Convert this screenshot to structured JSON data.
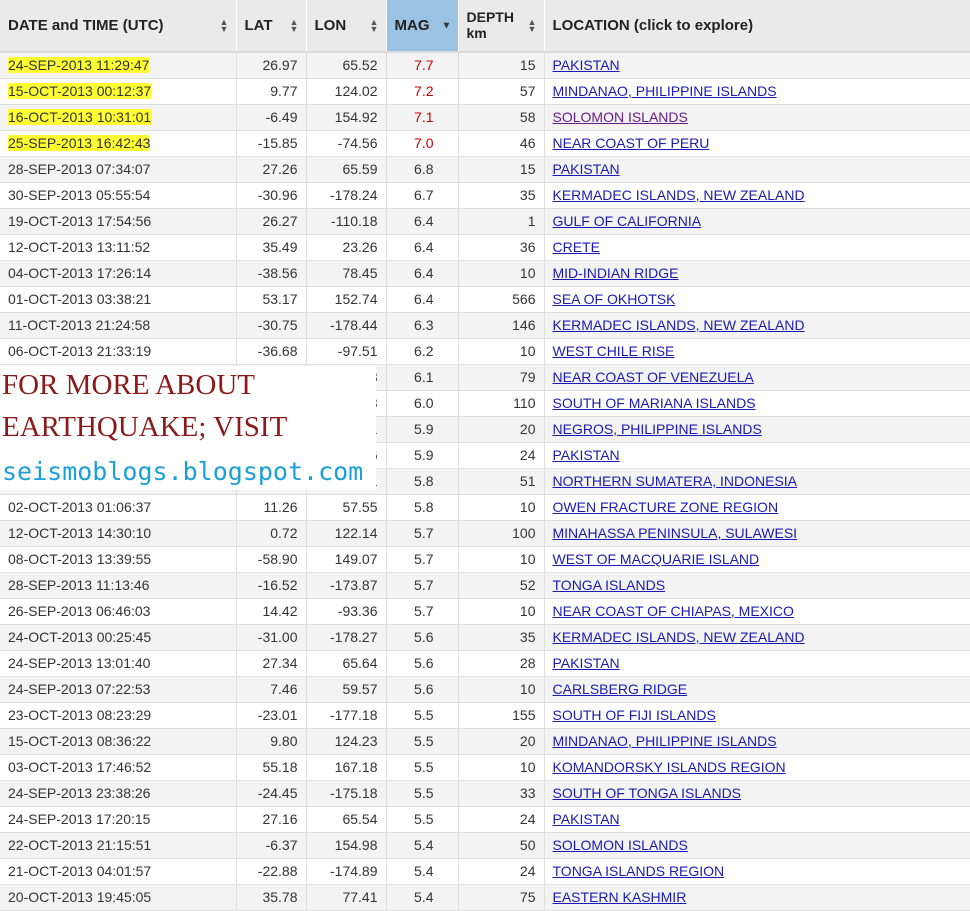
{
  "table": {
    "headers": {
      "date": "DATE and TIME (UTC)",
      "lat": "LAT",
      "lon": "LON",
      "mag": "MAG",
      "depth_line1": "DEPTH",
      "depth_line2": "km",
      "location": "LOCATION  (click to explore)"
    },
    "sort": {
      "column": "MAG",
      "direction": "descending"
    },
    "rows": [
      {
        "date": "24-SEP-2013 11:29:47",
        "lat": "26.97",
        "lon": "65.52",
        "mag": "7.7",
        "depth": "15",
        "location": "PAKISTAN"
      },
      {
        "date": "15-OCT-2013 00:12:37",
        "lat": "9.77",
        "lon": "124.02",
        "mag": "7.2",
        "depth": "57",
        "location": "MINDANAO, PHILIPPINE ISLANDS"
      },
      {
        "date": "16-OCT-2013 10:31:01",
        "lat": "-6.49",
        "lon": "154.92",
        "mag": "7.1",
        "depth": "58",
        "location": "SOLOMON ISLANDS"
      },
      {
        "date": "25-SEP-2013 16:42:43",
        "lat": "-15.85",
        "lon": "-74.56",
        "mag": "7.0",
        "depth": "46",
        "location": "NEAR COAST OF PERU"
      },
      {
        "date": "28-SEP-2013 07:34:07",
        "lat": "27.26",
        "lon": "65.59",
        "mag": "6.8",
        "depth": "15",
        "location": "PAKISTAN"
      },
      {
        "date": "30-SEP-2013 05:55:54",
        "lat": "-30.96",
        "lon": "-178.24",
        "mag": "6.7",
        "depth": "35",
        "location": "KERMADEC ISLANDS, NEW ZEALAND"
      },
      {
        "date": "19-OCT-2013 17:54:56",
        "lat": "26.27",
        "lon": "-110.18",
        "mag": "6.4",
        "depth": "1",
        "location": "GULF OF CALIFORNIA"
      },
      {
        "date": "12-OCT-2013 13:11:52",
        "lat": "35.49",
        "lon": "23.26",
        "mag": "6.4",
        "depth": "36",
        "location": "CRETE"
      },
      {
        "date": "04-OCT-2013 17:26:14",
        "lat": "-38.56",
        "lon": "78.45",
        "mag": "6.4",
        "depth": "10",
        "location": "MID-INDIAN RIDGE"
      },
      {
        "date": "01-OCT-2013 03:38:21",
        "lat": "53.17",
        "lon": "152.74",
        "mag": "6.4",
        "depth": "566",
        "location": "SEA OF OKHOTSK"
      },
      {
        "date": "11-OCT-2013 21:24:58",
        "lat": "-30.75",
        "lon": "-178.44",
        "mag": "6.3",
        "depth": "146",
        "location": "KERMADEC ISLANDS, NEW ZEALAND"
      },
      {
        "date": "06-OCT-2013 21:33:19",
        "lat": "-36.68",
        "lon": "-97.51",
        "mag": "6.2",
        "depth": "10",
        "location": "WEST CHILE RISE"
      },
      {
        "date": "",
        "lat": "",
        "lon": "3",
        "mag": "6.1",
        "depth": "79",
        "location": "NEAR COAST OF VENEZUELA"
      },
      {
        "date": "",
        "lat": "",
        "lon": "3",
        "mag": "6.0",
        "depth": "110",
        "location": "SOUTH OF MARIANA ISLANDS"
      },
      {
        "date": "",
        "lat": "",
        "lon": "1",
        "mag": "5.9",
        "depth": "20",
        "location": "NEGROS, PHILIPPINE ISLANDS"
      },
      {
        "date": "",
        "lat": "",
        "lon": "6",
        "mag": "5.9",
        "depth": "24",
        "location": "PAKISTAN"
      },
      {
        "date": "",
        "lat": "",
        "lon": "1",
        "mag": "5.8",
        "depth": "51",
        "location": "NORTHERN SUMATERA, INDONESIA"
      },
      {
        "date": "02-OCT-2013 01:06:37",
        "lat": "11.26",
        "lon": "57.55",
        "mag": "5.8",
        "depth": "10",
        "location": "OWEN FRACTURE ZONE REGION"
      },
      {
        "date": "12-OCT-2013 14:30:10",
        "lat": "0.72",
        "lon": "122.14",
        "mag": "5.7",
        "depth": "100",
        "location": "MINAHASSA PENINSULA, SULAWESI"
      },
      {
        "date": "08-OCT-2013 13:39:55",
        "lat": "-58.90",
        "lon": "149.07",
        "mag": "5.7",
        "depth": "10",
        "location": "WEST OF MACQUARIE ISLAND"
      },
      {
        "date": "28-SEP-2013 11:13:46",
        "lat": "-16.52",
        "lon": "-173.87",
        "mag": "5.7",
        "depth": "52",
        "location": "TONGA ISLANDS"
      },
      {
        "date": "26-SEP-2013 06:46:03",
        "lat": "14.42",
        "lon": "-93.36",
        "mag": "5.7",
        "depth": "10",
        "location": "NEAR COAST OF CHIAPAS, MEXICO"
      },
      {
        "date": "24-OCT-2013 00:25:45",
        "lat": "-31.00",
        "lon": "-178.27",
        "mag": "5.6",
        "depth": "35",
        "location": "KERMADEC ISLANDS, NEW ZEALAND"
      },
      {
        "date": "24-SEP-2013 13:01:40",
        "lat": "27.34",
        "lon": "65.64",
        "mag": "5.6",
        "depth": "28",
        "location": "PAKISTAN"
      },
      {
        "date": "24-SEP-2013 07:22:53",
        "lat": "7.46",
        "lon": "59.57",
        "mag": "5.6",
        "depth": "10",
        "location": "CARLSBERG RIDGE"
      },
      {
        "date": "23-OCT-2013 08:23:29",
        "lat": "-23.01",
        "lon": "-177.18",
        "mag": "5.5",
        "depth": "155",
        "location": "SOUTH OF FIJI ISLANDS"
      },
      {
        "date": "15-OCT-2013 08:36:22",
        "lat": "9.80",
        "lon": "124.23",
        "mag": "5.5",
        "depth": "20",
        "location": "MINDANAO, PHILIPPINE ISLANDS"
      },
      {
        "date": "03-OCT-2013 17:46:52",
        "lat": "55.18",
        "lon": "167.18",
        "mag": "5.5",
        "depth": "10",
        "location": "KOMANDORSKY ISLANDS REGION"
      },
      {
        "date": "24-SEP-2013 23:38:26",
        "lat": "-24.45",
        "lon": "-175.18",
        "mag": "5.5",
        "depth": "33",
        "location": "SOUTH OF TONGA ISLANDS"
      },
      {
        "date": "24-SEP-2013 17:20:15",
        "lat": "27.16",
        "lon": "65.54",
        "mag": "5.5",
        "depth": "24",
        "location": "PAKISTAN"
      },
      {
        "date": "22-OCT-2013 21:15:51",
        "lat": "-6.37",
        "lon": "154.98",
        "mag": "5.4",
        "depth": "50",
        "location": "SOLOMON ISLANDS"
      },
      {
        "date": "21-OCT-2013 04:01:57",
        "lat": "-22.88",
        "lon": "-174.89",
        "mag": "5.4",
        "depth": "24",
        "location": "TONGA ISLANDS REGION"
      },
      {
        "date": "20-OCT-2013 19:45:05",
        "lat": "35.78",
        "lon": "77.41",
        "mag": "5.4",
        "depth": "75",
        "location": "EASTERN KASHMIR"
      }
    ]
  },
  "highlighted_rows": [
    0,
    1,
    2,
    3
  ],
  "highlight_color": "#ffff33",
  "high_magnitude_color": "#cc0000",
  "link_color": "#1a1ab5",
  "visited_link_color": "#6a1b8a",
  "visited_rows": [
    2
  ],
  "promo": {
    "line1": "FOR MORE ABOUT",
    "line2": "EARTHQUAKE; VISIT",
    "line3": "seismoblogs.blogspot.com"
  }
}
